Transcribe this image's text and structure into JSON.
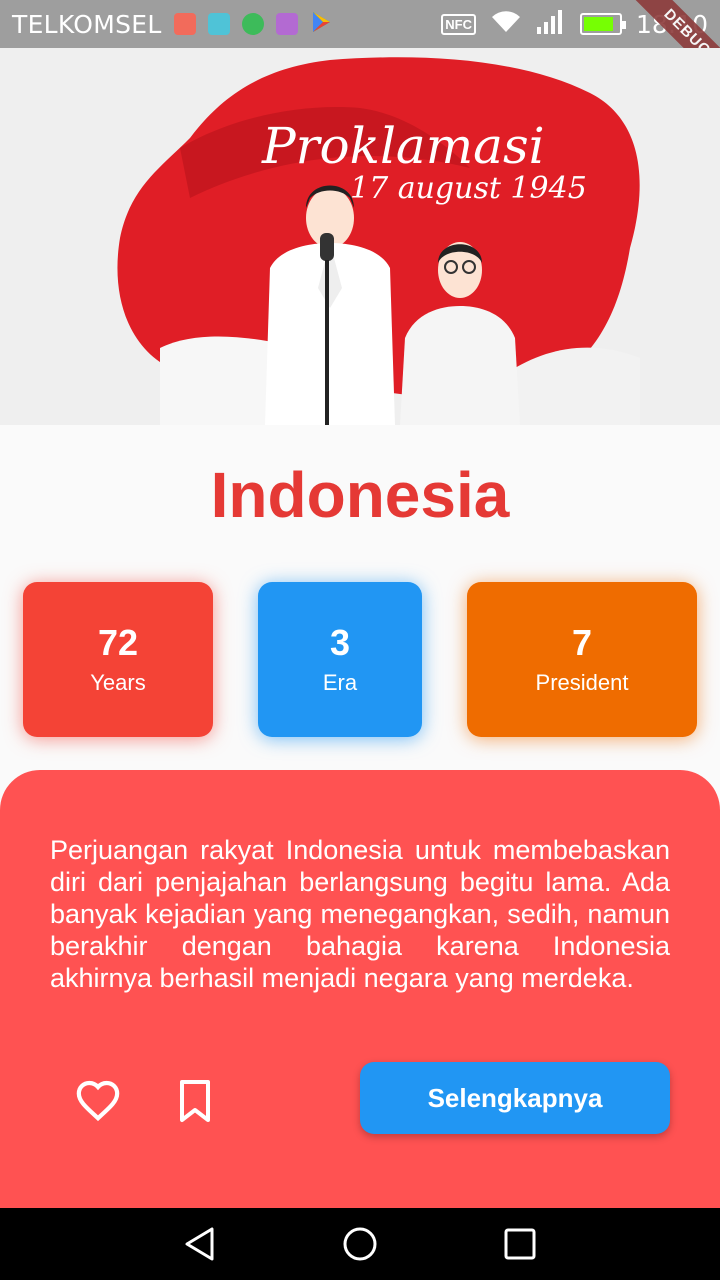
{
  "status_bar": {
    "carrier": "TELKOMSEL",
    "nfc_label": "NFC",
    "time": "18:10",
    "debug_label": "DEBUG",
    "battery_level": 0.85,
    "notification_icons": [
      "mail-icon",
      "android-icon",
      "whatsapp-icon",
      "gallery-icon",
      "play-store-icon"
    ]
  },
  "hero": {
    "headline": "Proklamasi",
    "date_text": "17 august 1945",
    "colors": {
      "flag_red": "#e01e26",
      "background": "#efefef"
    }
  },
  "title": "Indonesia",
  "stats": [
    {
      "value": "72",
      "label": "Years",
      "color": "#f44336"
    },
    {
      "value": "3",
      "label": "Era",
      "color": "#2196f3"
    },
    {
      "value": "7",
      "label": "President",
      "color": "#ef6c00"
    }
  ],
  "panel": {
    "description": "Perjuangan rakyat Indonesia untuk membebaskan diri dari penjajahan berlangsung begitu lama. Ada banyak kejadian yang menegangkan, sedih, namun berakhir dengan bahagia karena Indonesia akhirnya berhasil menjadi negara yang merdeka.",
    "more_button": "Selengkapnya",
    "background_color": "#ff5252"
  },
  "nav_bar": {
    "icons": [
      "back-icon",
      "home-icon",
      "recents-icon"
    ]
  }
}
